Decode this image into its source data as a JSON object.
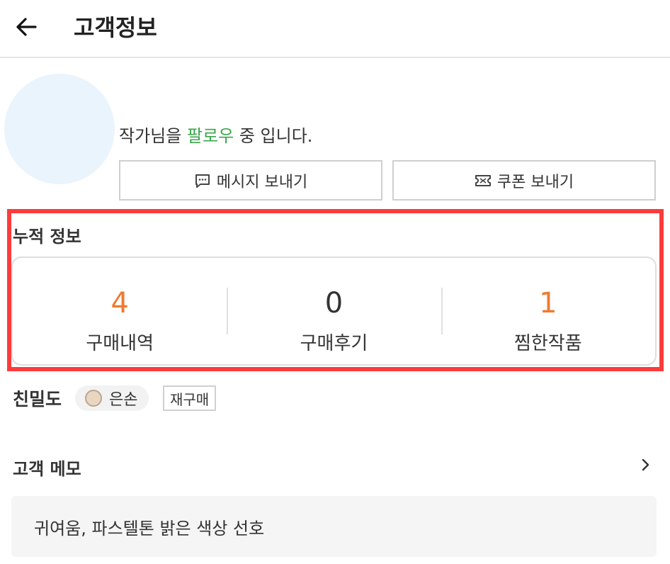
{
  "header": {
    "title": "고객정보"
  },
  "profile": {
    "follow_prefix": "작가님을 ",
    "follow_accent": "팔로우",
    "follow_suffix": " 중 입니다."
  },
  "actions": {
    "message_label": "메시지 보내기",
    "coupon_label": "쿠폰 보내기"
  },
  "accumulated": {
    "title": "누적 정보",
    "stats": [
      {
        "value": "4",
        "label": "구매내역",
        "color": "#ef7a2f"
      },
      {
        "value": "0",
        "label": "구매후기",
        "color": "#333333"
      },
      {
        "value": "1",
        "label": "찜한작품",
        "color": "#ef7a2f"
      }
    ]
  },
  "intimacy": {
    "label": "친밀도",
    "level": "은손",
    "tag": "재구매"
  },
  "memo": {
    "title": "고객 메모",
    "content": "귀여움, 파스텔톤 밝은 색상 선호"
  },
  "colors": {
    "accent_green": "#3aa64b",
    "accent_orange": "#ef7a2f",
    "highlight_red": "#ff3b3b"
  }
}
